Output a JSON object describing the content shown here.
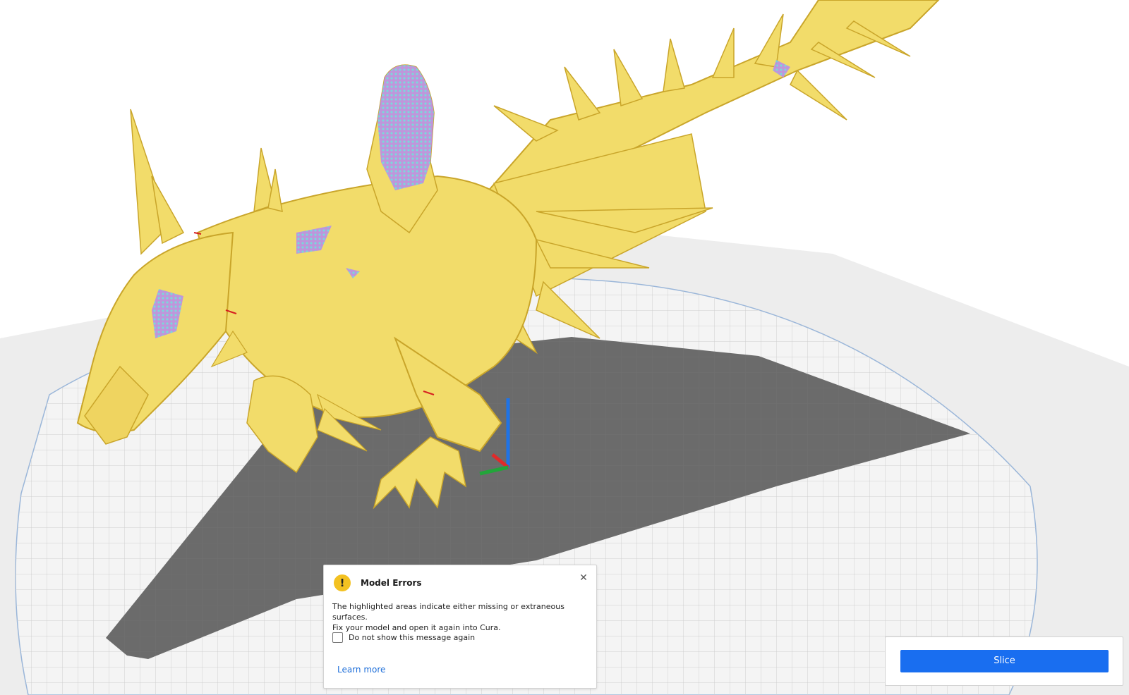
{
  "app": {
    "name": "Cura"
  },
  "viewport": {
    "model_color": "#f2dc6a",
    "model_shadow_color": "#c9a52a",
    "error_highlight_color": "#b98ee8",
    "build_plate_color": "#e9e9e9",
    "shadow_color": "#6b6b6b",
    "axes": {
      "x_color": "#e02a2a",
      "y_color": "#1f73e6",
      "z_color": "#22a53a"
    }
  },
  "message": {
    "icon": "warning-icon",
    "title": "Model Errors",
    "body_line1": "The highlighted areas indicate either missing or extraneous surfaces.",
    "body_line2": "Fix your model and open it again into Cura.",
    "checkbox_label": "Do not show this message again",
    "checkbox_checked": false,
    "learn_more": "Learn more",
    "close_icon": "close-icon"
  },
  "action_panel": {
    "slice_label": "Slice",
    "slice_color": "#196ef0"
  }
}
